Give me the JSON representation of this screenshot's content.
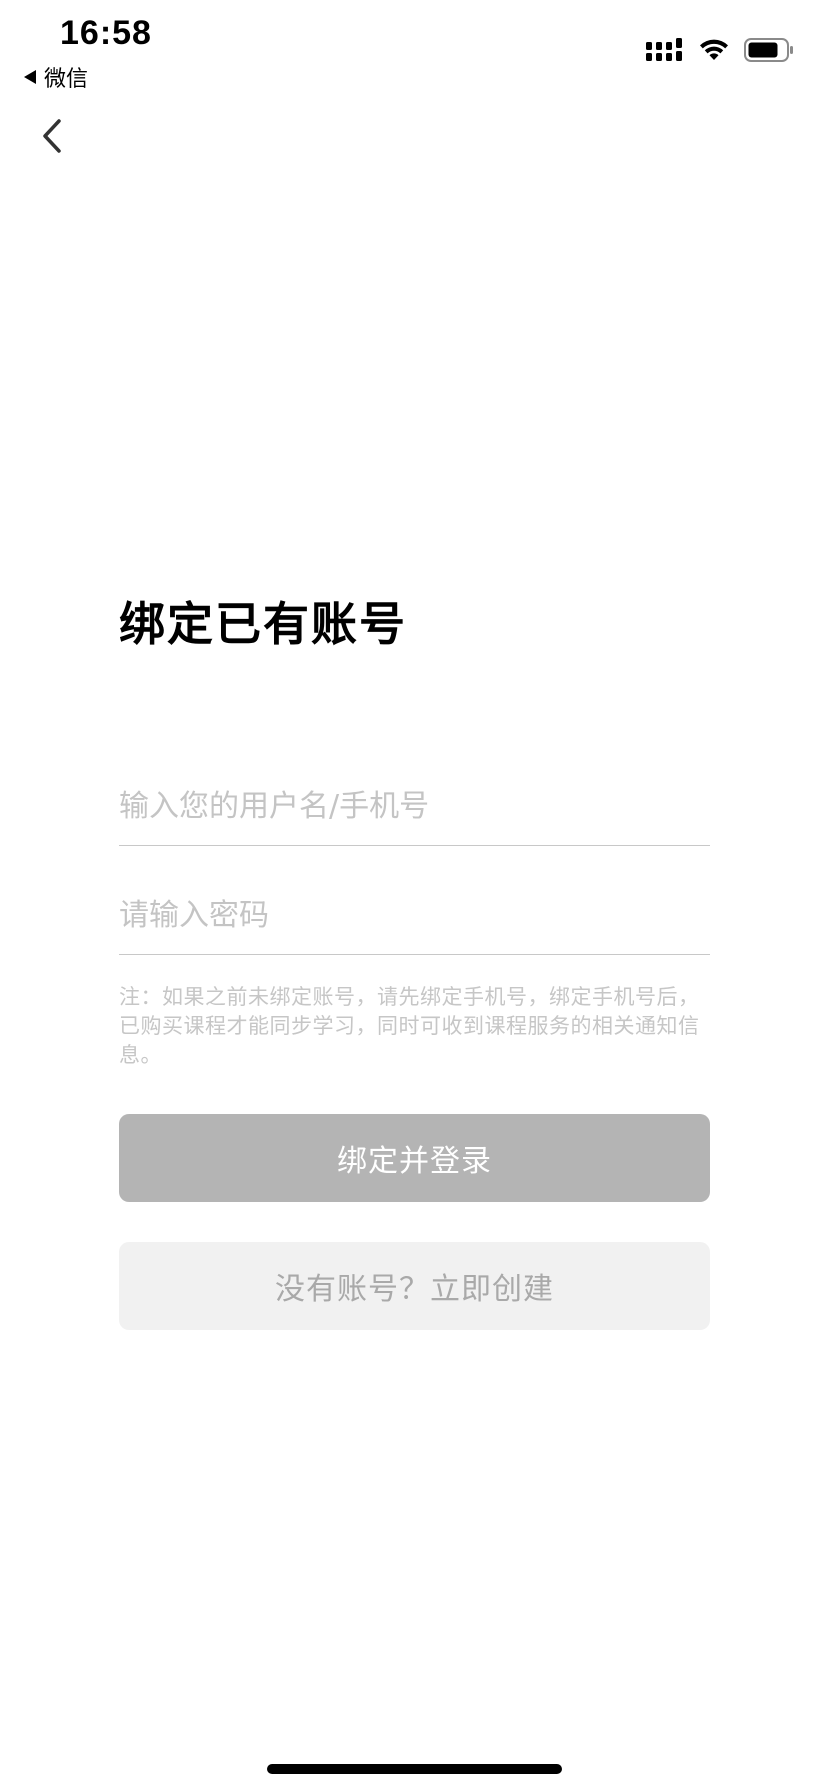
{
  "status_bar": {
    "time": "16:58",
    "back_app_label": "微信",
    "icons": [
      "cellular-signal-icon",
      "wifi-icon",
      "battery-icon"
    ]
  },
  "nav": {
    "back_icon": "chevron-left-icon"
  },
  "page": {
    "title": "绑定已有账号"
  },
  "form": {
    "username_placeholder": "输入您的用户名/手机号",
    "username_value": "",
    "password_placeholder": "请输入密码",
    "password_value": "",
    "note": "注：如果之前未绑定账号，请先绑定手机号，绑定手机号后，已购买课程才能同步学习，同时可收到课程服务的相关通知信息。"
  },
  "actions": {
    "bind_login_label": "绑定并登录",
    "create_account_label": "没有账号？立即创建"
  },
  "colors": {
    "primary_button_bg": "#b4b4b4",
    "secondary_button_bg": "#f1f1f1",
    "placeholder_text": "#c4c4c4",
    "note_text": "#c6c6c6"
  }
}
